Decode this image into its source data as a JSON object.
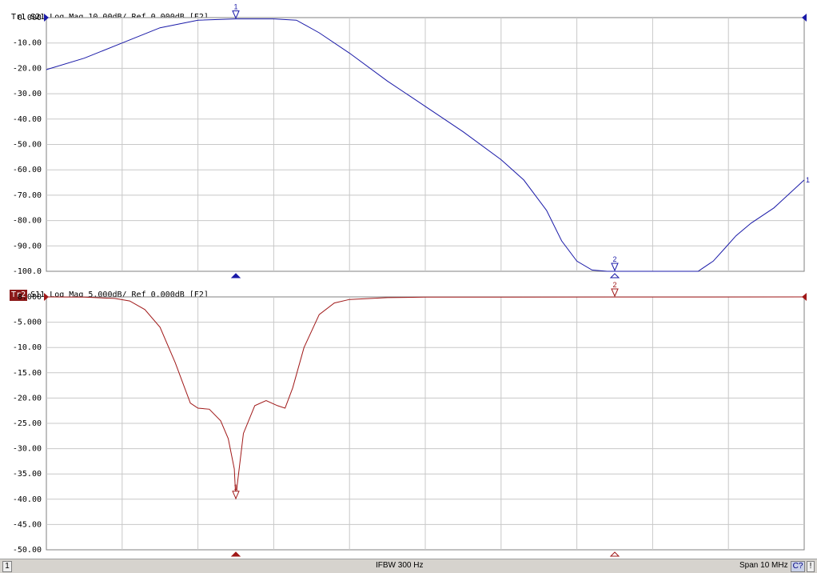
{
  "trace1": {
    "badge": "Tr1",
    "title": "S21 Log Mag 10.00dB/ Ref 0.000dB [F2]",
    "color": "#1a1aa8",
    "ylim": [
      -100,
      0
    ],
    "yticks": [
      "0.000",
      "-10.00",
      "-20.00",
      "-30.00",
      "-40.00",
      "-50.00",
      "-60.00",
      "-70.00",
      "-80.00",
      "-90.00",
      "-100.0"
    ],
    "marker_labels": [
      "1"
    ],
    "end_label": "1"
  },
  "trace2": {
    "badge": "Tr2",
    "title": "S11 Log Mag 5.000dB/ Ref 0.000dB [F2]",
    "color": "#a01818",
    "ylim": [
      -50,
      0
    ],
    "yticks": [
      "0.000",
      "-5.000",
      "-10.00",
      "-15.00",
      "-20.00",
      "-25.00",
      "-30.00",
      "-35.00",
      "-40.00",
      "-45.00",
      "-50.00"
    ],
    "marker_labels": [
      "1",
      "2"
    ]
  },
  "status": {
    "channel": "1",
    "ifbw": "IFBW 300 Hz",
    "span": "Span 10 MHz",
    "cal": "C?",
    "warn": "!"
  },
  "chart_data": [
    {
      "type": "line",
      "title": "S21 Log Mag 10.00dB/ Ref 0.000dB [F2]",
      "xlabel": "",
      "ylabel": "",
      "xlim": [
        0,
        10
      ],
      "ylim": [
        -100,
        0
      ],
      "grid": true,
      "series": [
        {
          "name": "S21",
          "x": [
            0,
            0.5,
            1.0,
            1.5,
            2.0,
            2.5,
            3.0,
            3.3,
            3.6,
            4.0,
            4.5,
            5.0,
            5.5,
            6.0,
            6.3,
            6.6,
            6.8,
            7.0,
            7.2,
            7.4,
            7.5,
            7.55,
            8.0,
            8.1,
            8.6,
            8.65,
            8.8,
            8.95,
            9.1,
            9.3,
            9.6,
            10.0
          ],
          "y": [
            -20.5,
            -16,
            -10,
            -4,
            -1,
            -0.5,
            -0.5,
            -1,
            -6,
            -14,
            -25,
            -35,
            -45,
            -56,
            -64,
            -76,
            -88,
            -96,
            -99.5,
            -100,
            -100,
            -100,
            -100,
            -100,
            -100,
            -99,
            -96,
            -91,
            -86,
            -81,
            -75,
            -64
          ]
        }
      ],
      "markers": [
        {
          "label": "1",
          "x": 2.5,
          "y": -0.5
        },
        {
          "label": "2",
          "x": 7.5,
          "y": -100
        }
      ]
    },
    {
      "type": "line",
      "title": "S11 Log Mag 5.000dB/ Ref 0.000dB [F2]",
      "xlabel": "",
      "ylabel": "",
      "xlim": [
        0,
        10
      ],
      "ylim": [
        -50,
        0
      ],
      "grid": true,
      "series": [
        {
          "name": "S11",
          "x": [
            0,
            0.5,
            0.9,
            1.1,
            1.3,
            1.5,
            1.7,
            1.9,
            2.0,
            2.15,
            2.3,
            2.4,
            2.48,
            2.5,
            2.52,
            2.6,
            2.75,
            2.9,
            3.05,
            3.15,
            3.25,
            3.4,
            3.6,
            3.8,
            4.0,
            4.5,
            5.0,
            10.0
          ],
          "y": [
            0,
            -0.05,
            -0.3,
            -0.8,
            -2.5,
            -6,
            -13,
            -21,
            -22,
            -22.2,
            -24.5,
            -28,
            -34,
            -40,
            -37,
            -27,
            -21.5,
            -20.5,
            -21.5,
            -22,
            -18,
            -10,
            -3.5,
            -1.2,
            -0.5,
            -0.15,
            -0.05,
            0
          ]
        }
      ],
      "markers": [
        {
          "label": "1",
          "x": 2.5,
          "y": -40
        },
        {
          "label": "2",
          "x": 7.5,
          "y": 0
        }
      ]
    }
  ]
}
